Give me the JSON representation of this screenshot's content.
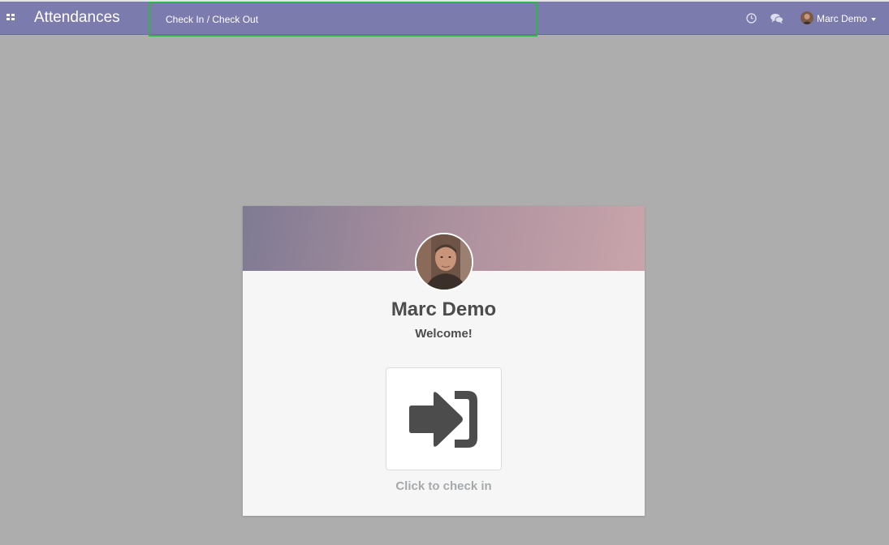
{
  "navbar": {
    "app_title": "Attendances",
    "menu_item": "Check In / Check Out",
    "user_name": "Marc Demo",
    "icons": {
      "apps": "apps-grid-icon",
      "activity": "clock-icon",
      "messaging": "chat-icon",
      "user_menu_caret": "caret-down-icon"
    }
  },
  "kiosk": {
    "employee_name": "Marc Demo",
    "greeting": "Welcome!",
    "action_label": "Click to check in",
    "action_icon": "sign-in-icon"
  },
  "colors": {
    "navbar_bg": "#7c7bad",
    "page_bg": "#adadad",
    "card_bg": "#f6f6f6",
    "highlight_border": "#2fb34a",
    "icon_dark": "#4c4c4c",
    "muted_text": "#a6a9ac"
  }
}
